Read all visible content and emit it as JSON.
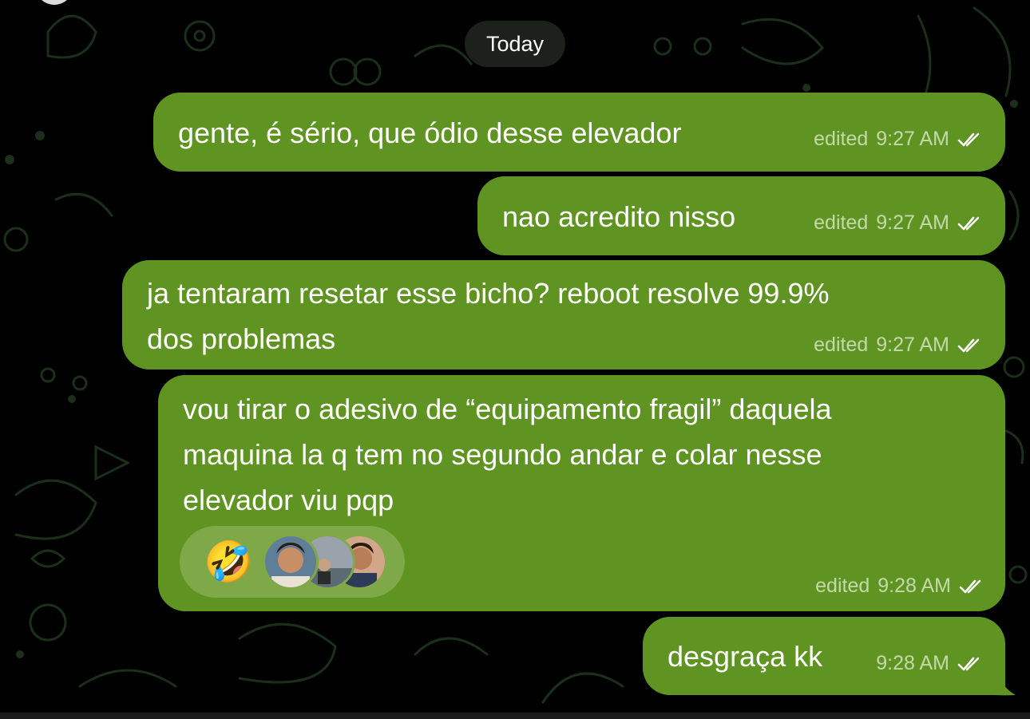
{
  "chat": {
    "date_separator": "Today",
    "messages": [
      {
        "text_lines": [
          "gente, é sério, que ódio desse elevador"
        ],
        "status": "edited",
        "time": "9:27 AM"
      },
      {
        "text_lines": [
          "nao acredito nisso"
        ],
        "status": "edited",
        "time": "9:27 AM"
      },
      {
        "text_lines": [
          "ja tentaram resetar esse bicho? reboot resolve 99.9%",
          "dos problemas"
        ],
        "status": "edited",
        "time": "9:27 AM"
      },
      {
        "text_lines": [
          "vou tirar o adesivo de “equipamento fragil” daquela",
          "maquina la q tem no segundo andar e colar nesse",
          "elevador viu pqp"
        ],
        "status": "edited",
        "time": "9:28 AM",
        "reaction": {
          "emoji": "🤣",
          "emoji_name": "rolling-on-floor-laughing",
          "reactor_count": 3
        }
      },
      {
        "text_lines": [
          "desgraça kk"
        ],
        "status": "",
        "time": "9:28 AM"
      }
    ]
  },
  "colors": {
    "background": "#000000",
    "bubble_outgoing": "#609422",
    "meta_text": "#c4d9aa",
    "date_pill": "#1c211c"
  }
}
